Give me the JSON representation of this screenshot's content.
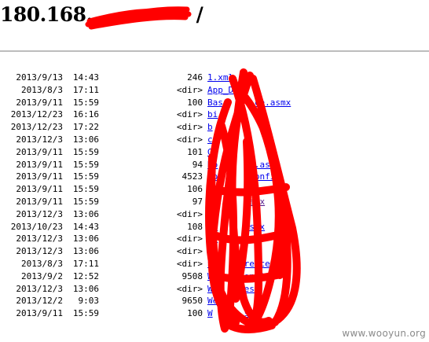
{
  "page": {
    "title_visible": "180.168.",
    "title_suffix": "/",
    "redaction_color": "#ff0000",
    "link_color": "#0000ee",
    "visited_link_color": "#551a8b"
  },
  "files": [
    {
      "date": "2013/9/13",
      "time": "14:43",
      "size": "246",
      "name": "1.xml"
    },
    {
      "date": "2013/8/3",
      "time": "17:11",
      "size": "<dir>",
      "name": "App_D"
    },
    {
      "date": "2013/9/11",
      "time": "15:59",
      "size": "100",
      "name": "Bas",
      "name_tail": "ce.asmx"
    },
    {
      "date": "2013/12/23",
      "time": "16:16",
      "size": "<dir>",
      "name": "bi"
    },
    {
      "date": "2013/12/23",
      "time": "17:22",
      "size": "<dir>",
      "name": "b"
    },
    {
      "date": "2013/12/3",
      "time": "13:06",
      "size": "<dir>",
      "name": "c"
    },
    {
      "date": "2013/9/11",
      "time": "15:59",
      "size": "101",
      "name": "G",
      "name_tail": "x"
    },
    {
      "date": "2013/9/11",
      "time": "15:59",
      "size": "94",
      "name": "Ho",
      "name_tail": "g.asmx"
    },
    {
      "date": "2013/9/11",
      "time": "15:59",
      "size": "4523",
      "name": "Lo",
      "name_tail": "config"
    },
    {
      "date": "2013/9/11",
      "time": "15:59",
      "size": "106",
      "name": "Me",
      "name_tail": "asmx",
      "visited": true
    },
    {
      "date": "2013/9/11",
      "time": "15:59",
      "size": "97",
      "name": "Me",
      "name_tail": "smx",
      "visited": true
    },
    {
      "date": "2013/12/3",
      "time": "13:06",
      "size": "<dir>",
      "name": "ob"
    },
    {
      "date": "2013/10/23",
      "time": "14:43",
      "size": "108",
      "name": "Pa",
      "name_tail": "spx"
    },
    {
      "date": "2013/12/3",
      "time": "13:06",
      "size": "<dir>",
      "name": "Pr",
      "name_tail": "es"
    },
    {
      "date": "2013/12/3",
      "time": "13:06",
      "size": "<dir>",
      "name": "S"
    },
    {
      "date": "2013/8/3",
      "time": "17:11",
      "size": "<dir>",
      "name": "S",
      "name_tail": "rences"
    },
    {
      "date": "2013/9/2",
      "time": "12:52",
      "size": "9508",
      "name": "W",
      "name_tail": "onfig"
    },
    {
      "date": "2013/12/3",
      "time": "13:06",
      "size": "<dir>",
      "name": "W",
      "name_tail": "es"
    },
    {
      "date": "2013/12/2",
      "time": "9:03",
      "size": "9650",
      "name": "We"
    },
    {
      "date": "2013/9/11",
      "time": "15:59",
      "size": "100",
      "name": "W",
      "name_tail": "smx"
    }
  ],
  "watermark": "www.wooyun.org"
}
